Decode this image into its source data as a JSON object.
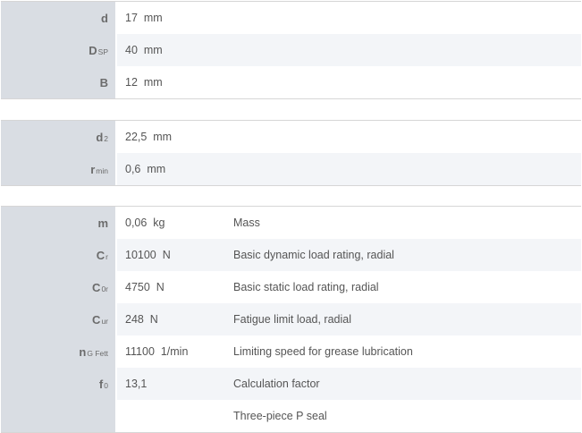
{
  "groups": [
    {
      "rows": [
        {
          "sym": "d",
          "sub": "",
          "value": "17  mm",
          "desc": ""
        },
        {
          "sym": "D",
          "sub": "SP",
          "value": "40  mm",
          "desc": ""
        },
        {
          "sym": "B",
          "sub": "",
          "value": "12  mm",
          "desc": ""
        }
      ]
    },
    {
      "rows": [
        {
          "sym": "d",
          "sub": "2",
          "value": "22,5  mm",
          "desc": ""
        },
        {
          "sym": "r",
          "sub": "min",
          "value": "0,6  mm",
          "desc": ""
        }
      ]
    },
    {
      "rows": [
        {
          "sym": "m",
          "sub": "",
          "value": "0,06  kg",
          "desc": "Mass"
        },
        {
          "sym": "C",
          "sub": "r",
          "value": "10100  N",
          "desc": "Basic dynamic load rating, radial"
        },
        {
          "sym": "C",
          "sub": "0r",
          "value": "4750  N",
          "desc": "Basic static load rating, radial"
        },
        {
          "sym": "C",
          "sub": "ur",
          "value": "248  N",
          "desc": "Fatigue limit load, radial"
        },
        {
          "sym": "n",
          "sub": "G Fett",
          "value": "11100  1/min",
          "desc": "Limiting speed for grease lubrication"
        },
        {
          "sym": "f",
          "sub": "0",
          "value": "13,1",
          "desc": "Calculation factor"
        },
        {
          "sym": "",
          "sub": "",
          "value": "",
          "desc": "Three-piece P seal"
        }
      ]
    }
  ]
}
